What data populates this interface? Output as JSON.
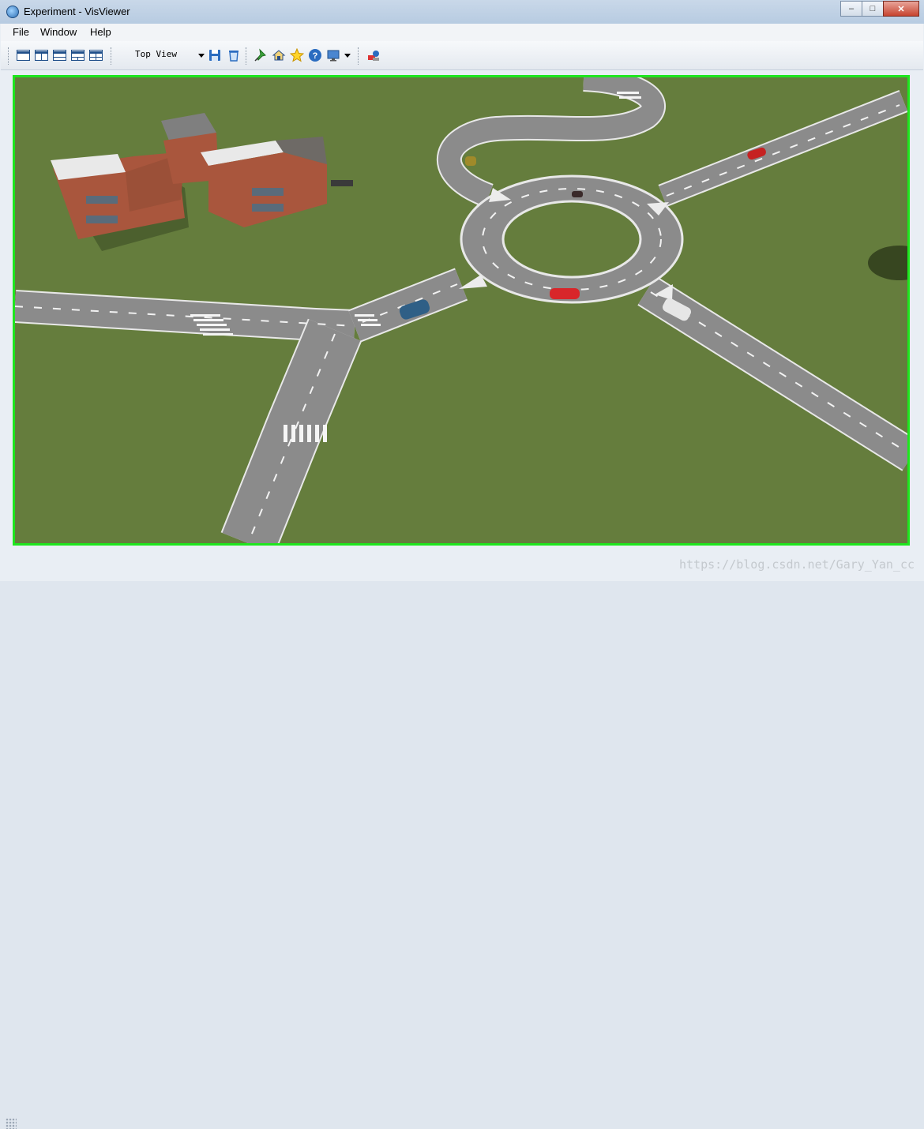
{
  "window": {
    "title": "Experiment - VisViewer",
    "icon": "app-globe-icon"
  },
  "caption_buttons": {
    "minimize": "–",
    "maximize": "□",
    "close": "✕"
  },
  "menu": {
    "items": [
      "File",
      "Window",
      "Help"
    ]
  },
  "toolbar": {
    "layout_buttons": [
      "single-view-icon",
      "split-vertical-icon",
      "split-horizontal-icon",
      "three-view-icon",
      "quad-view-icon"
    ],
    "view_select": {
      "value": "Top View"
    },
    "file_buttons": [
      "save-icon",
      "delete-icon"
    ],
    "tool_buttons": [
      "pin-icon",
      "home-view-icon",
      "favorite-star-icon",
      "help-icon",
      "display-monitor-icon"
    ],
    "extra_buttons": [
      "scene-objects-icon"
    ]
  },
  "viewport": {
    "border_color": "#1ee61e",
    "ground_color": "#657d3d",
    "road_color": "#8c8c8c"
  },
  "watermark": "https://blog.csdn.net/Gary_Yan_cc"
}
